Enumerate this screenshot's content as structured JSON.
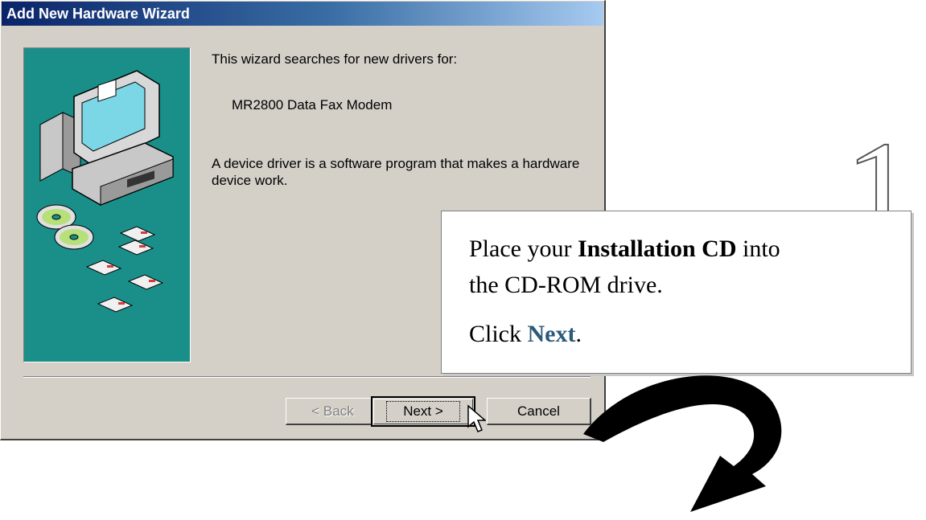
{
  "window": {
    "title": "Add New Hardware Wizard"
  },
  "content": {
    "intro": "This wizard searches for new drivers for:",
    "device": "MR2800 Data Fax Modem",
    "description": "A device driver is a software program that makes a hardware device work."
  },
  "buttons": {
    "back": "< Back",
    "next": "Next >",
    "cancel": "Cancel"
  },
  "callout": {
    "step_number": "1",
    "line1_prefix": "Place your ",
    "line1_bold": "Installation CD",
    "line1_suffix": " into",
    "line2": "the CD-ROM drive.",
    "line3_prefix": "Click ",
    "line3_link": "Next",
    "line3_suffix": "."
  },
  "colors": {
    "panel_teal": "#1a8f8a",
    "title_bar": "#0a246a",
    "callout_link": "#2b5a7a"
  },
  "icons": [
    "computer-icon",
    "cd-disc-icon",
    "floppy-disk-icon",
    "mouse-cursor-icon",
    "curved-arrow-icon"
  ]
}
